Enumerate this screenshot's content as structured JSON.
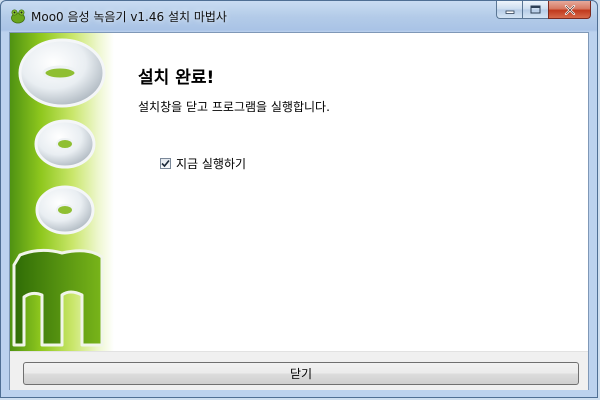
{
  "window": {
    "title": "Moo0 음성 녹음기 v1.46 설치 마법사",
    "icon": "frog-app-icon",
    "controls": {
      "minimize": "minimize-icon",
      "maximize": "maximize-icon",
      "close": "close-icon"
    }
  },
  "side_banner": {
    "logo_text": "Moo0"
  },
  "main": {
    "heading": "설치 완료!",
    "description": "설치창을 닫고 프로그램을 실행합니다.",
    "run_now": {
      "label": "지금 실행하기",
      "checked": true
    }
  },
  "footer": {
    "close_label": "닫기"
  },
  "colors": {
    "accent_green": "#8fc81e",
    "dark_green": "#4f9212",
    "frame_blue": "#b3cbe8"
  }
}
